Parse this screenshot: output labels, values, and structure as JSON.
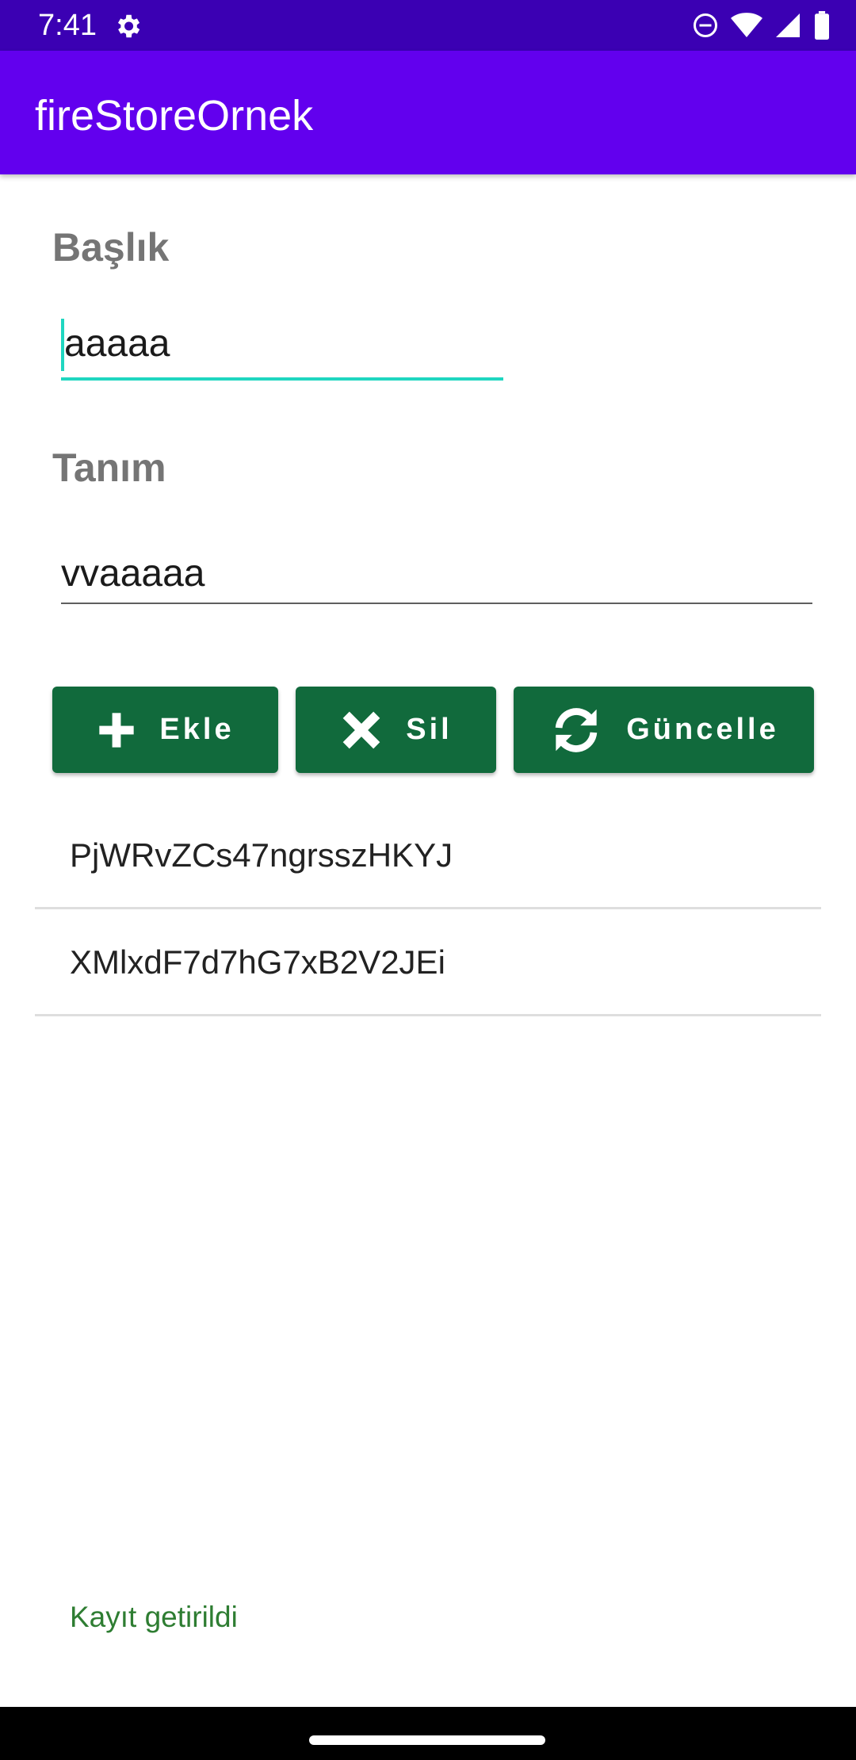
{
  "status_bar": {
    "time": "7:41",
    "icons": [
      "settings-icon",
      "do-not-disturb-icon",
      "wifi-icon",
      "signal-icon",
      "battery-icon"
    ]
  },
  "app_bar": {
    "title": "fireStoreOrnek",
    "color": "#6200ee"
  },
  "form": {
    "title_label": "Başlık",
    "title_value": "aaaaa",
    "description_label": "Tanım",
    "description_value": "vvaaaaa"
  },
  "buttons": {
    "add": {
      "label": "Ekle",
      "icon": "plus-icon"
    },
    "delete": {
      "label": "Sil",
      "icon": "close-icon"
    },
    "update": {
      "label": "Güncelle",
      "icon": "refresh-icon"
    },
    "color": "#116a3c"
  },
  "list": {
    "items": [
      "PjWRvZCs47ngrsszHKYJ",
      "XMlxdF7d7hG7xB2V2JEi"
    ]
  },
  "status_message": "Kayıt getirildi"
}
